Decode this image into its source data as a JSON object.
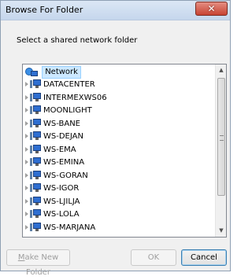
{
  "dialog": {
    "title": "Browse For Folder",
    "close_glyph": "✕",
    "instruction": "Select a shared network folder"
  },
  "tree": {
    "root": {
      "label": "Network",
      "icon": "network-icon",
      "selected": true
    },
    "items": [
      {
        "label": "DATACENTER"
      },
      {
        "label": "INTERMEXWS06"
      },
      {
        "label": "MOONLIGHT"
      },
      {
        "label": "WS-BANE"
      },
      {
        "label": "WS-DEJAN"
      },
      {
        "label": "WS-EMA"
      },
      {
        "label": "WS-EMINA"
      },
      {
        "label": "WS-GORAN"
      },
      {
        "label": "WS-IGOR"
      },
      {
        "label": "WS-LJILJA"
      },
      {
        "label": "WS-LOLA"
      },
      {
        "label": "WS-MARJANA"
      }
    ],
    "scroll_up_glyph": "▲",
    "scroll_down_glyph": "▼"
  },
  "buttons": {
    "make_new_folder_first": "M",
    "make_new_folder_rest": "ake New Folder",
    "ok": "OK",
    "cancel": "Cancel"
  }
}
